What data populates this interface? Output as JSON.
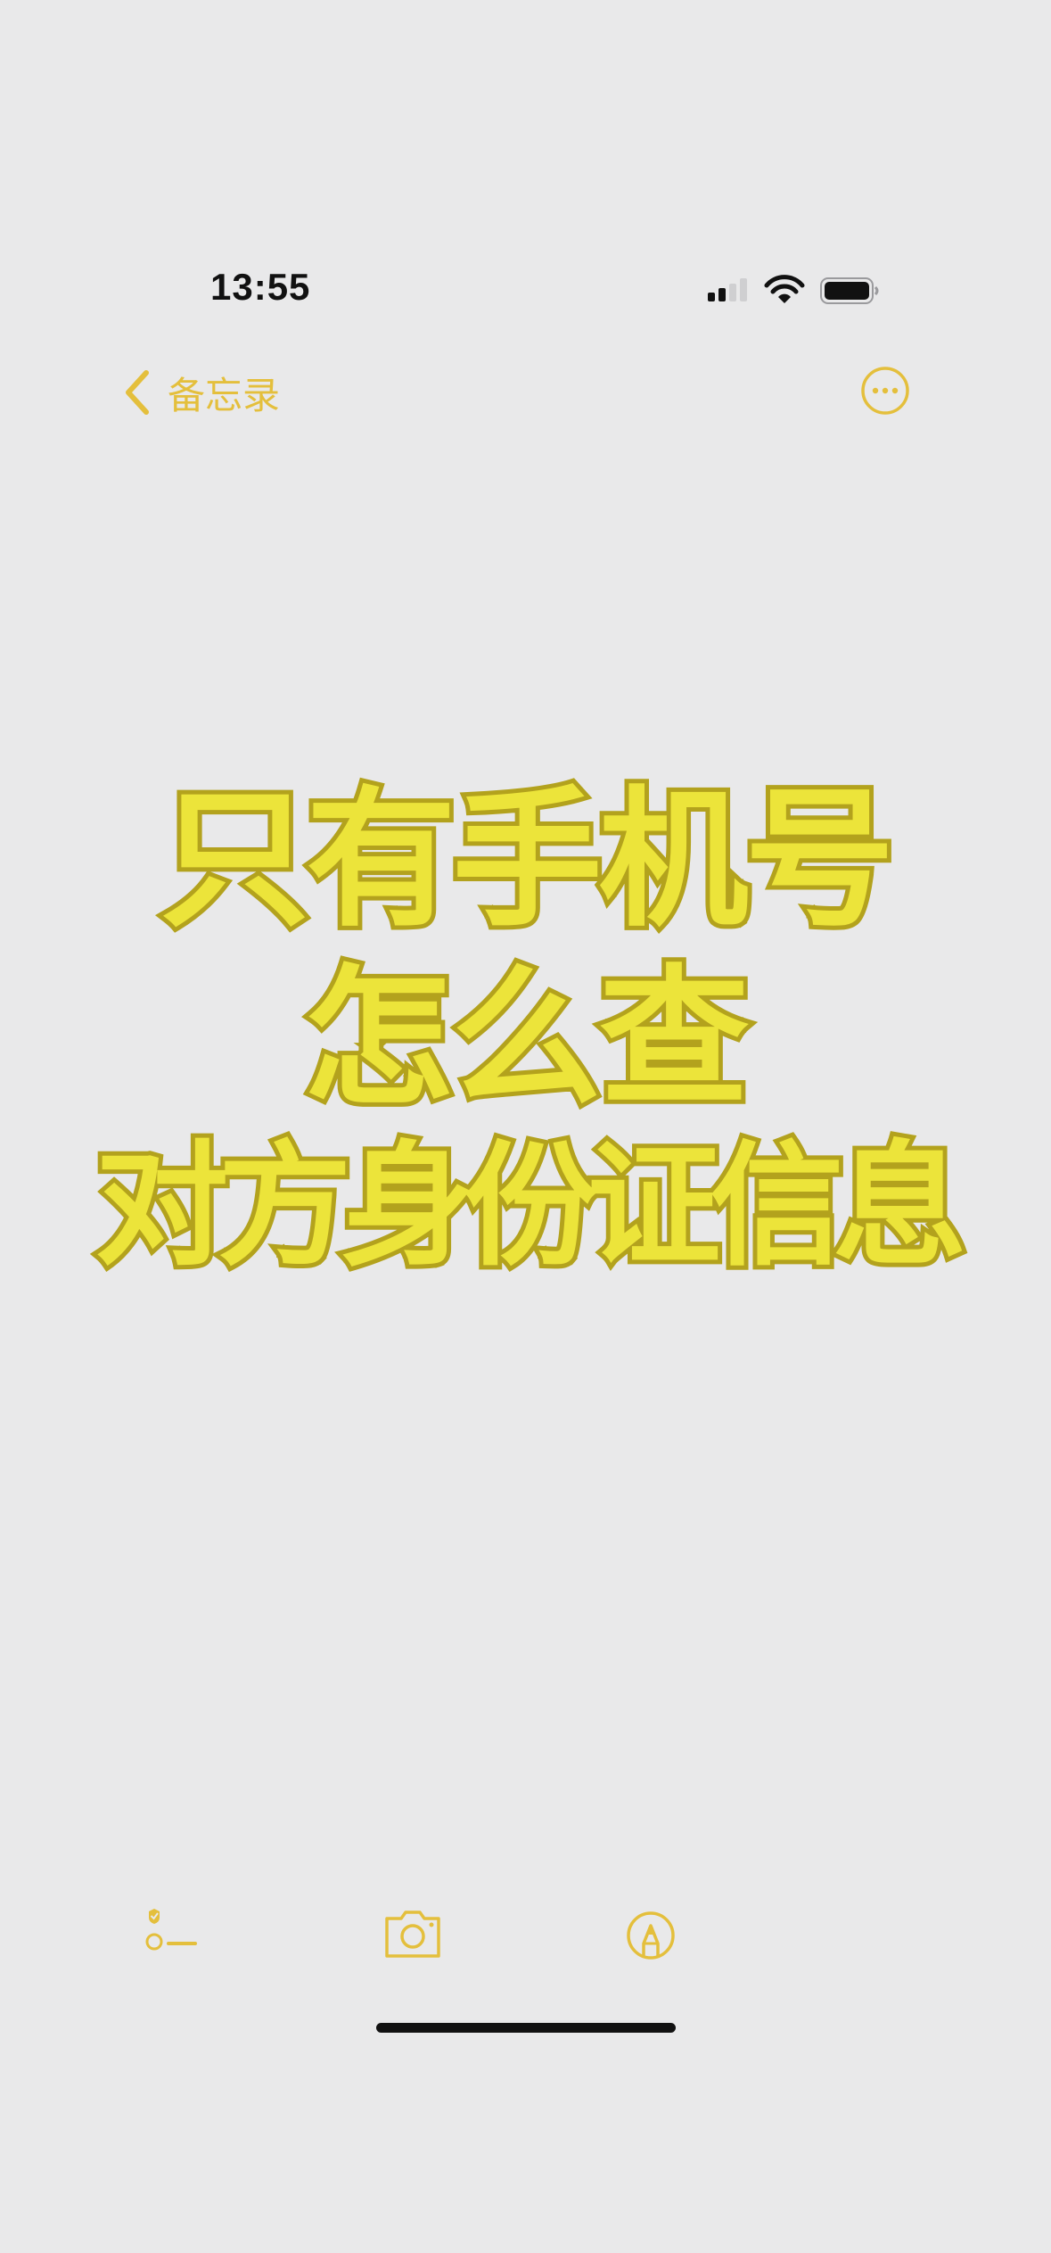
{
  "status_bar": {
    "time": "13:55",
    "icons": [
      "cellular-signal-icon",
      "wifi-icon",
      "battery-icon"
    ]
  },
  "nav": {
    "back_label": "备忘录",
    "back_icon": "chevron-left-icon",
    "more_icon": "ellipsis-circle-icon"
  },
  "note": {
    "lines": [
      "只有手机号",
      "怎么查",
      "对方身份证信息"
    ]
  },
  "toolbar": {
    "items": [
      {
        "icon": "checklist-icon"
      },
      {
        "icon": "camera-icon"
      },
      {
        "icon": "markup-icon"
      }
    ]
  },
  "colors": {
    "background": "#e9e9ea",
    "accent": "#e4bf3c",
    "title_fill": "#ece43a",
    "title_stroke": "#b3a21d"
  }
}
